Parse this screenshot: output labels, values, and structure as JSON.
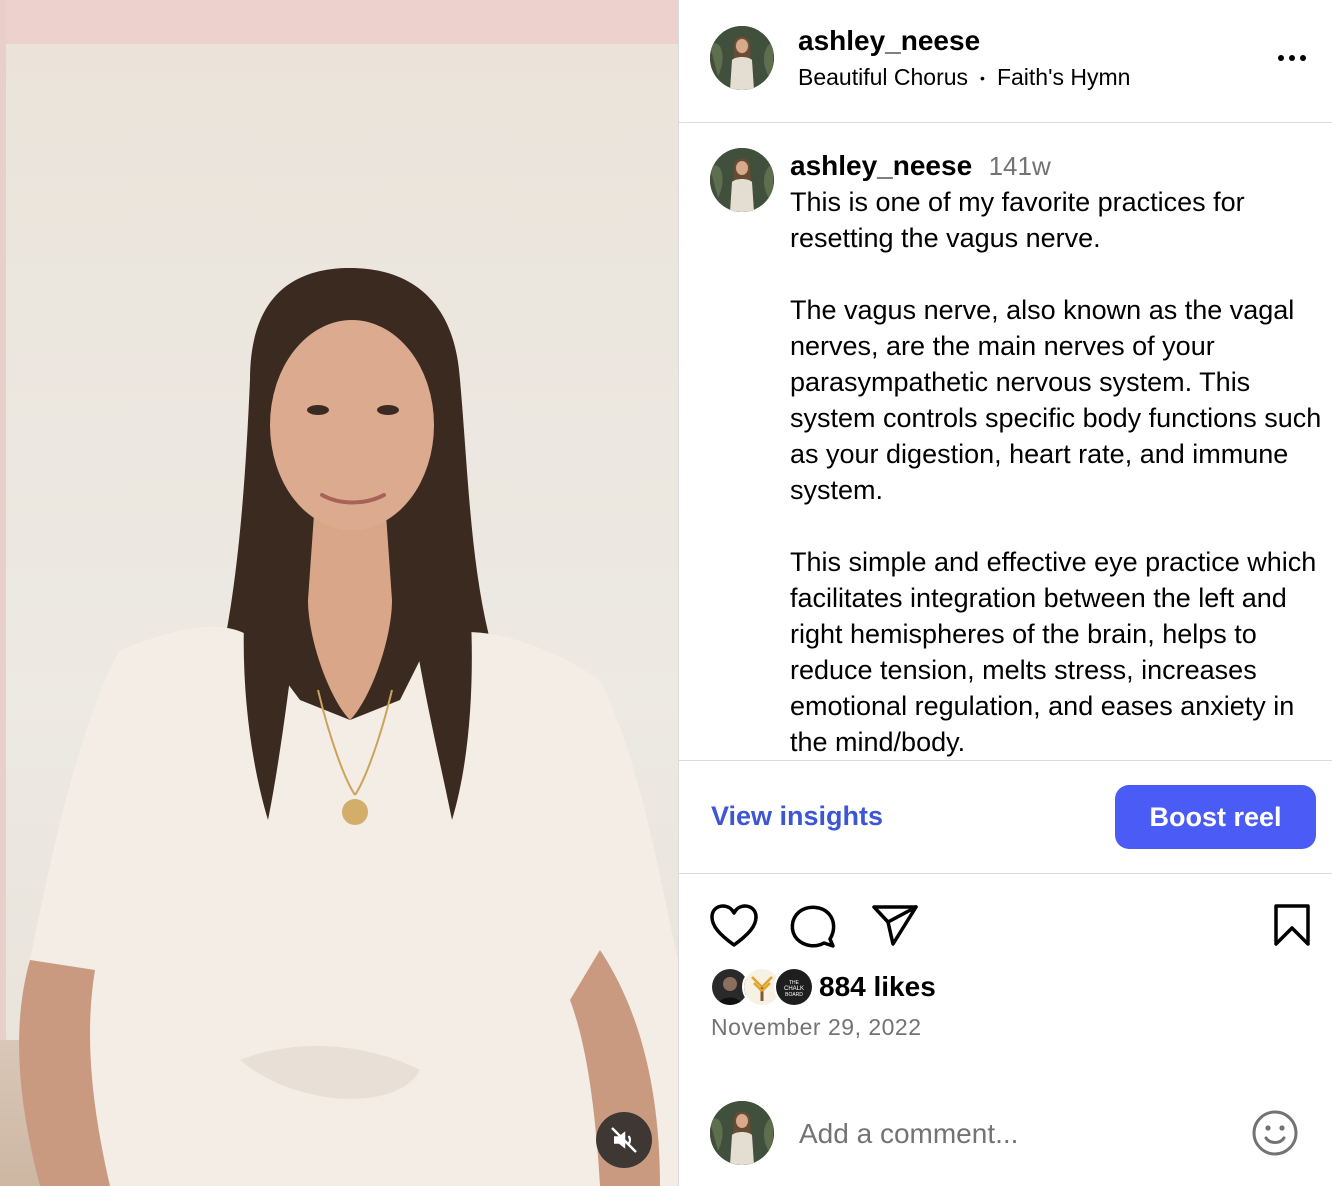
{
  "post": {
    "username": "ashley_neese",
    "audio_artist": "Beautiful Chorus",
    "audio_separator": "•",
    "audio_track": "Faith's Hymn"
  },
  "caption": {
    "username": "ashley_neese",
    "age": "141w",
    "text": "This is one of my favorite practices for resetting the vagus nerve.\n\nThe vagus nerve, also known as the vagal nerves, are the main nerves of your parasympathetic nervous system. This system controls specific body functions such as your digestion, heart rate, and immune system.\n\nThis simple and effective eye practice which facilitates integration between the left and right hemispheres of the brain, helps to reduce tension, melts stress, increases emotional regulation, and eases anxiety in the mind/body."
  },
  "actions": {
    "view_insights_label": "View insights",
    "boost_label": "Boost reel"
  },
  "engagement": {
    "likes": "884 likes",
    "date": "November 29, 2022",
    "likers": [
      {
        "icon": "avatar-dark-icon"
      },
      {
        "icon": "avatar-tree-icon"
      },
      {
        "icon": "avatar-chalkboard-icon",
        "label": "THE CHALK BOARD"
      }
    ]
  },
  "comment": {
    "placeholder": "Add a comment..."
  },
  "icons": {
    "more": "more-options-icon",
    "like": "heart-icon",
    "comment": "comment-bubble-icon",
    "share": "paper-plane-icon",
    "save": "bookmark-icon",
    "emoji": "smiley-icon",
    "mute": "muted-speaker-icon"
  },
  "colors": {
    "accent": "#4a5cf5",
    "link": "#3d56d6",
    "secondary_text": "#737373",
    "border": "#dbdbdb"
  }
}
